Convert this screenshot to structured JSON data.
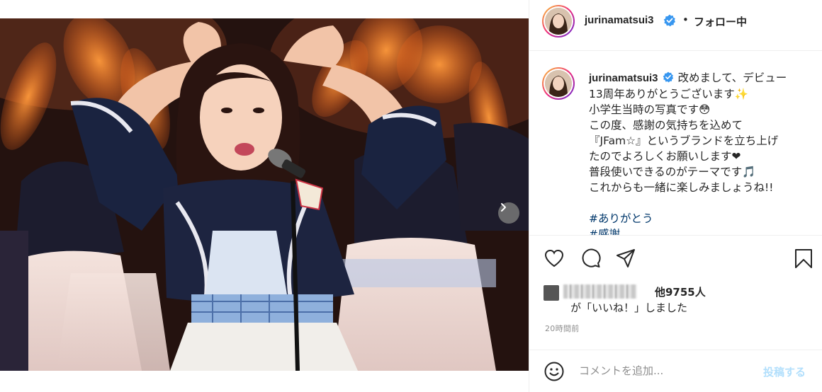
{
  "post": {
    "username": "jurinamatsui3",
    "separator": "•",
    "follow_status": "フォロー中",
    "caption_lines": [
      "改めまして、デビュー",
      "13周年ありがとうございます✨",
      "小学生当時の写真です😳",
      "この度、感謝の気持ちを込めて",
      "『JFam☆』というブランドを立ち上げ",
      "たのでよろしくお願いします❤",
      "普段使いできるのがテーマです🎵",
      "これからも一緒に楽しみましょうね!!"
    ],
    "hashtags": [
      "#ありがとう",
      "#感謝"
    ],
    "likes_others": "他9755人",
    "likes_suffix": "が「いいね！」しました",
    "timestamp": "20時間前",
    "comment_placeholder": "コメントを追加...",
    "post_button": "投稿する"
  },
  "colors": {
    "verified": "#3897f0",
    "hashtag": "#00376b",
    "post_disabled": "#b2dffc",
    "muted": "#8e8e8e"
  },
  "icons": [
    "verified-badge-icon",
    "carousel-next-icon",
    "heart-icon",
    "comment-icon",
    "share-icon",
    "bookmark-icon",
    "emoji-icon"
  ]
}
